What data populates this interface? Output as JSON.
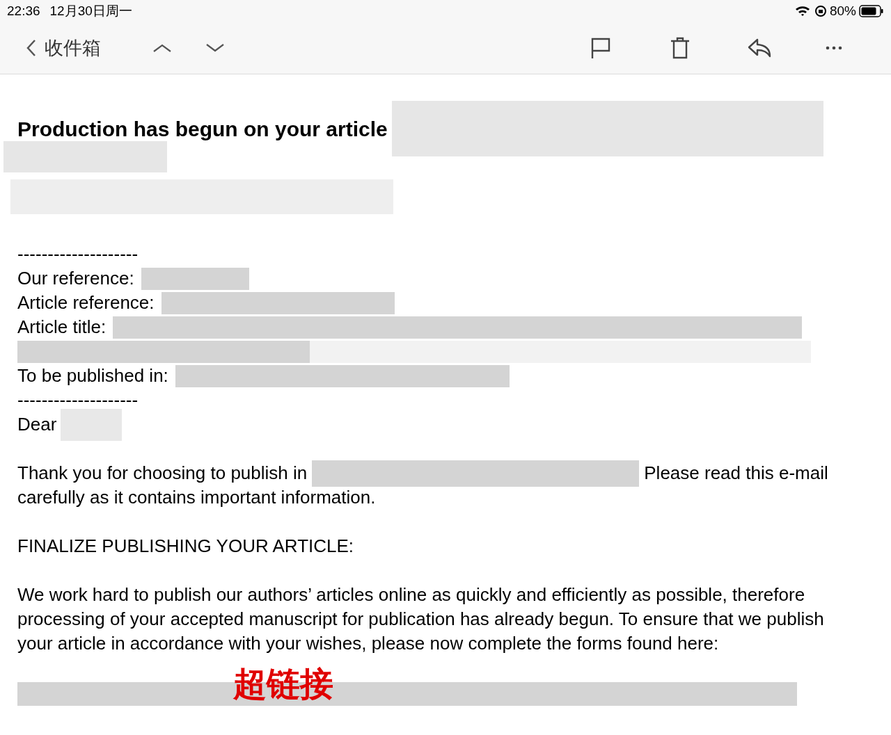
{
  "status_bar": {
    "time": "22:36",
    "date": "12月30日周一",
    "battery": "80%"
  },
  "toolbar": {
    "back_label": "收件箱"
  },
  "email": {
    "subject": "Production has begun on your article",
    "separator_top": "--------------------",
    "fields": [
      {
        "label": "Our reference:"
      },
      {
        "label": "Article reference:"
      },
      {
        "label": "Article title:"
      },
      {
        "label": "To be published in:"
      }
    ],
    "separator_bottom": "--------------------",
    "greeting": "Dear",
    "intro_before": "Thank you for choosing to publish in",
    "intro_after": "Please read this e-mail",
    "intro_continued": "carefully as it contains important information.",
    "section_heading": "FINALIZE PUBLISHING YOUR ARTICLE:",
    "body": "We work hard to publish our authors’ articles online as quickly and efficiently as possible, therefore processing of your accepted manuscript for publication has already begun. To ensure that we publish your article in accordance with your wishes, please now complete the forms found here:",
    "annotation": "超链接"
  }
}
